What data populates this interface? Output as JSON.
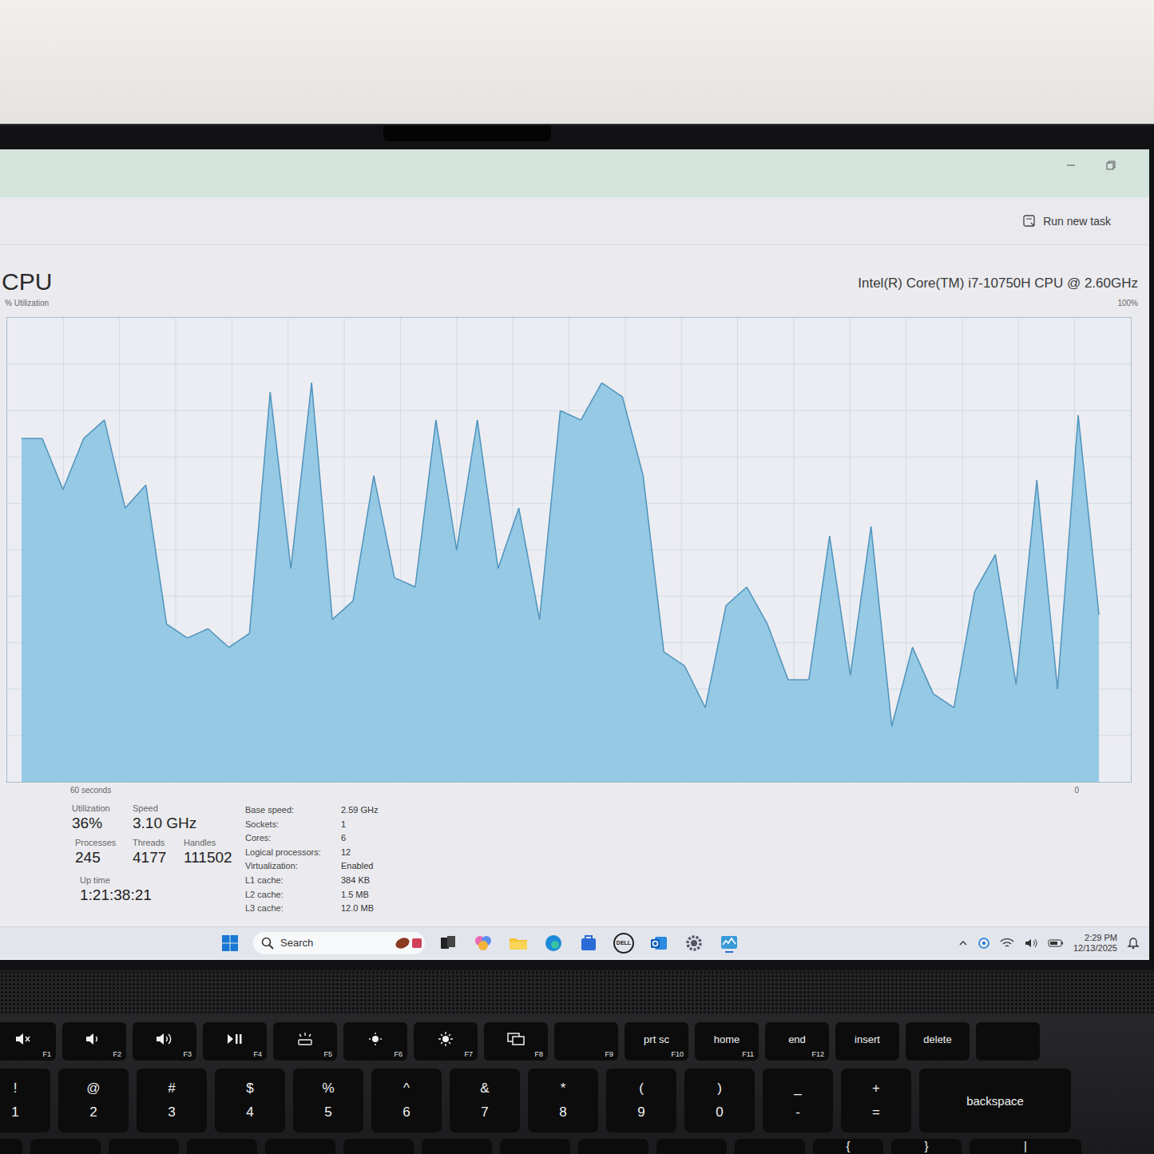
{
  "command_bar": {
    "run_new_task": "Run new task"
  },
  "cpu": {
    "title": "CPU",
    "processor": "Intel(R) Core(TM) i7-10750H CPU @ 2.60GHz",
    "axis_label": "% Utilization",
    "axis_max": "100%",
    "axis_min": "0",
    "time_span": "60 seconds",
    "values": [
      74,
      74,
      63,
      74,
      78,
      59,
      64,
      34,
      31,
      33,
      29,
      32,
      84,
      46,
      86,
      35,
      39,
      66,
      44,
      42,
      78,
      50,
      78,
      46,
      59,
      35,
      80,
      78,
      86,
      83,
      66,
      28,
      25,
      16,
      38,
      42,
      34,
      22,
      22,
      53,
      23,
      55,
      12,
      29,
      19,
      16,
      41,
      49,
      21,
      65,
      20,
      79,
      36
    ]
  },
  "stats": [
    {
      "label": "Utilization",
      "value": "36%"
    },
    {
      "label": "Speed",
      "value": "3.10 GHz"
    },
    {
      "label": "Processes",
      "value": "245"
    },
    {
      "label": "Threads",
      "value": "4177"
    },
    {
      "label": "Handles",
      "value": "111502"
    },
    {
      "label": "Up time",
      "value": "1:21:38:21"
    }
  ],
  "details": [
    {
      "label": "Base speed:",
      "value": "2.59 GHz"
    },
    {
      "label": "Sockets:",
      "value": "1"
    },
    {
      "label": "Cores:",
      "value": "6"
    },
    {
      "label": "Logical processors:",
      "value": "12"
    },
    {
      "label": "Virtualization:",
      "value": "Enabled"
    },
    {
      "label": "L1 cache:",
      "value": "384 KB"
    },
    {
      "label": "L2 cache:",
      "value": "1.5 MB"
    },
    {
      "label": "L3 cache:",
      "value": "12.0 MB"
    }
  ],
  "taskbar": {
    "search": "Search",
    "dell_logo": "DELL",
    "time": "2:29 PM",
    "date": "12/13/2025"
  },
  "keyboard": {
    "function_keys": [
      {
        "kind": "icon",
        "fn": "F1"
      },
      {
        "kind": "icon",
        "fn": "F2"
      },
      {
        "kind": "icon",
        "fn": "F3"
      },
      {
        "kind": "icon",
        "fn": "F4"
      },
      {
        "kind": "icon",
        "fn": "F5"
      },
      {
        "kind": "icon",
        "fn": "F6"
      },
      {
        "kind": "icon",
        "fn": "F7"
      },
      {
        "kind": "icon",
        "fn": "F8"
      },
      {
        "kind": "fnonly",
        "fn": "F9"
      },
      {
        "kind": "text",
        "label": "prt sc",
        "fn": "F10"
      },
      {
        "kind": "text",
        "label": "home",
        "fn": "F11"
      },
      {
        "kind": "text",
        "label": "end",
        "fn": "F12"
      },
      {
        "kind": "plain",
        "label": "insert"
      },
      {
        "kind": "plain",
        "label": "delete"
      },
      {
        "kind": "blank"
      }
    ],
    "number_keys": [
      {
        "top": "!",
        "bottom": "1"
      },
      {
        "top": "@",
        "bottom": "2"
      },
      {
        "top": "#",
        "bottom": "3"
      },
      {
        "top": "$",
        "bottom": "4"
      },
      {
        "top": "%",
        "bottom": "5"
      },
      {
        "top": "^",
        "bottom": "6"
      },
      {
        "top": "&",
        "bottom": "7"
      },
      {
        "top": "*",
        "bottom": "8"
      },
      {
        "top": "(",
        "bottom": "9"
      },
      {
        "top": ")",
        "bottom": "0"
      },
      {
        "top": "_",
        "bottom": "-"
      },
      {
        "top": "+",
        "bottom": "="
      }
    ],
    "backspace": "backspace",
    "bottom_row": [
      "{",
      "}",
      "|"
    ]
  }
}
